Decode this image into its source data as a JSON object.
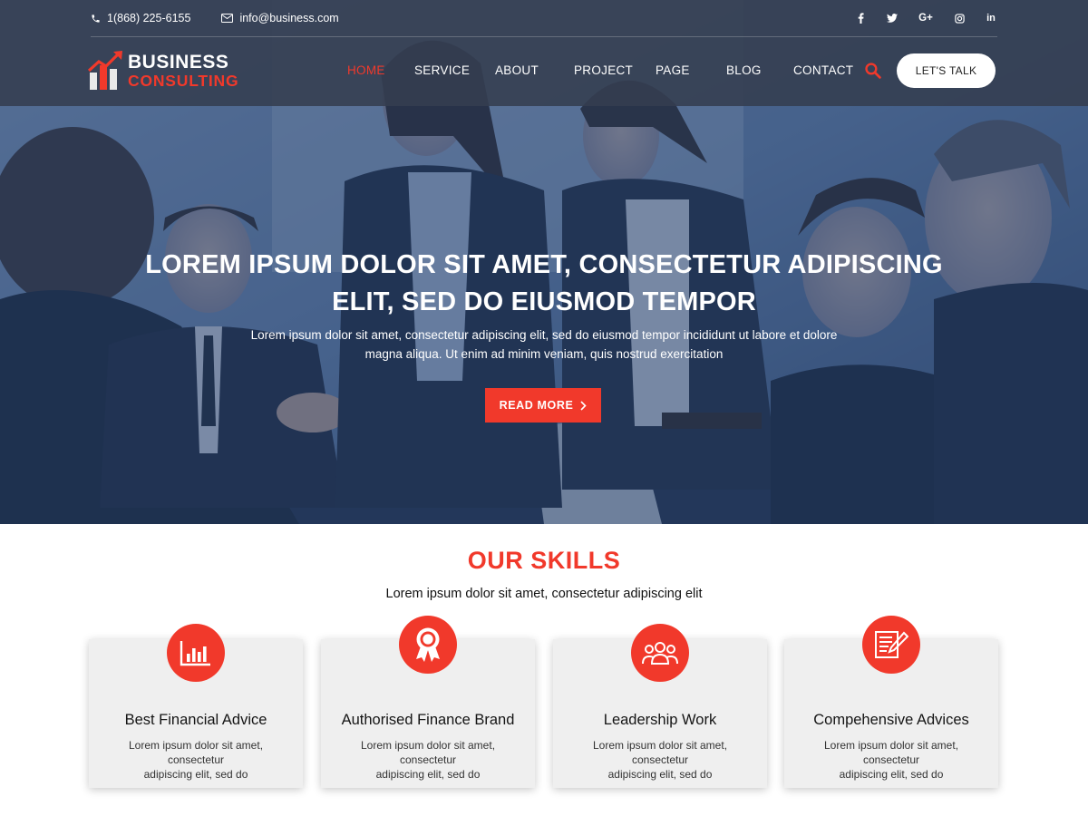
{
  "topbar": {
    "phone": "1(868) 225-6155",
    "email": "info@business.com",
    "social": [
      {
        "label": "f",
        "icon": "facebook-icon"
      },
      {
        "label": "twitter",
        "icon": "twitter-icon"
      },
      {
        "label": "G+",
        "icon": "google-plus-icon"
      },
      {
        "label": "instagram",
        "icon": "instagram-icon"
      },
      {
        "label": "in",
        "icon": "linkedin-icon"
      }
    ]
  },
  "logo": {
    "line1": "BUSINESS",
    "line2": "CONSULTING"
  },
  "nav": {
    "items": [
      "HOME",
      "SERVICE",
      "ABOUT",
      "PROJECT",
      "PAGE",
      "BLOG",
      "CONTACT"
    ],
    "active": "HOME",
    "cta": "LET'S TALK"
  },
  "hero": {
    "title_line1": "LOREM IPSUM DOLOR SIT AMET, CONSECTETUR ADIPISCING",
    "title_line2": "ELIT, SED DO EIUSMOD TEMPOR",
    "desc_line1": "Lorem ipsum dolor sit amet, consectetur adipiscing elit, sed do eiusmod tempor incididunt ut labore et dolore",
    "desc_line2": "magna aliqua. Ut enim ad minim veniam, quis nostrud exercitation",
    "button": "READ MORE"
  },
  "skills": {
    "title": "OUR SKILLS",
    "subtitle": "Lorem ipsum dolor sit amet, consectetur adipiscing elit",
    "cards": [
      {
        "title": "Best Financial Advice",
        "text_line1": "Lorem ipsum dolor sit amet, consectetur",
        "text_line2": "adipiscing elit, sed do",
        "icon": "bar-chart-icon"
      },
      {
        "title": "Authorised Finance Brand",
        "text_line1": "Lorem ipsum dolor sit amet, consectetur",
        "text_line2": "adipiscing elit, sed do",
        "icon": "award-ribbon-icon"
      },
      {
        "title": "Leadership Work",
        "text_line1": "Lorem ipsum dolor sit amet, consectetur",
        "text_line2": "adipiscing elit, sed do",
        "icon": "team-icon"
      },
      {
        "title": "Compehensive Advices",
        "text_line1": "Lorem ipsum dolor sit amet, consectetur",
        "text_line2": "adipiscing elit, sed do",
        "icon": "document-edit-icon"
      }
    ]
  },
  "colors": {
    "accent": "#f1392b",
    "header_bg": "#343e50",
    "hero_overlay": "#26426e",
    "card_bg": "#efefef"
  }
}
